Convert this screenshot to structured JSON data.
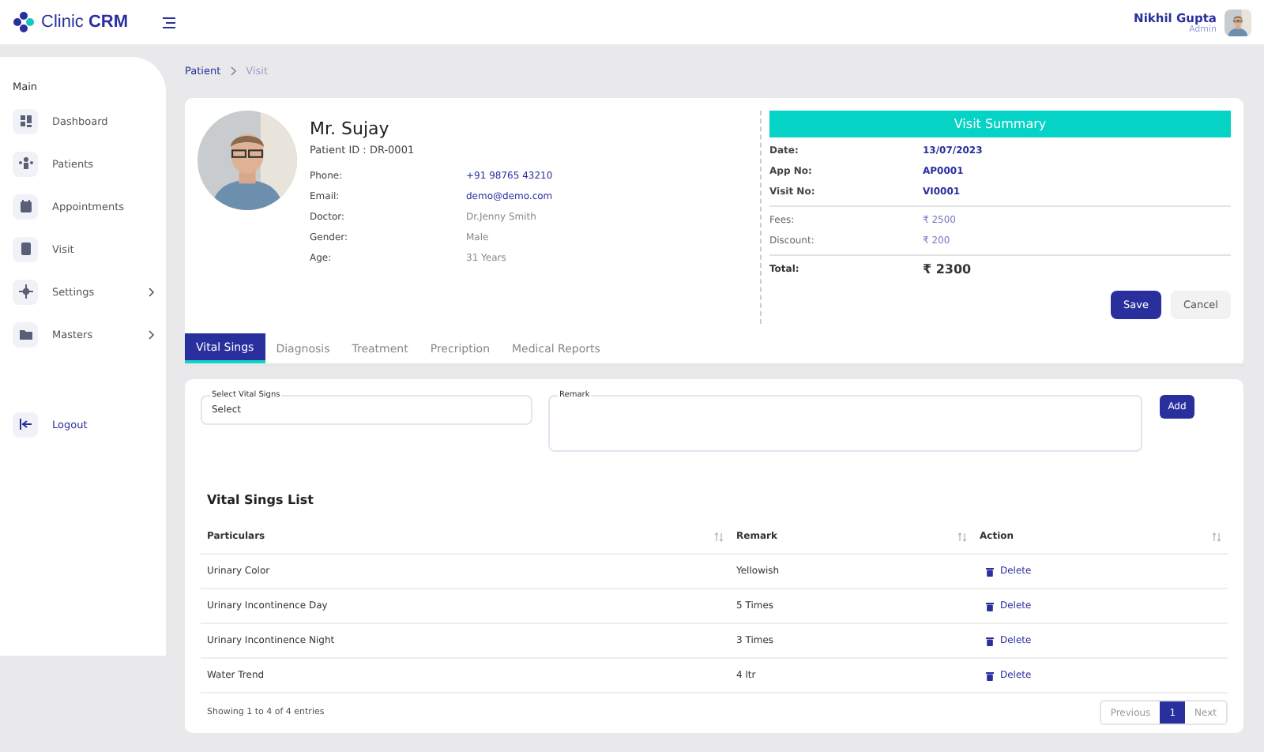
{
  "brand": {
    "name": "Clinic",
    "accent": "CRM"
  },
  "user": {
    "name": "Nikhil Gupta",
    "role": "Admin"
  },
  "sidebar": {
    "section": "Main",
    "items": [
      {
        "label": "Dashboard",
        "expandable": false
      },
      {
        "label": "Patients",
        "expandable": false
      },
      {
        "label": "Appointments",
        "expandable": false
      },
      {
        "label": "Visit",
        "expandable": false
      },
      {
        "label": "Settings",
        "expandable": true
      },
      {
        "label": "Masters",
        "expandable": true
      }
    ],
    "logout": "Logout"
  },
  "breadcrumb": [
    {
      "label": "Patient",
      "selected": false
    },
    {
      "label": "Visit",
      "selected": true
    }
  ],
  "patient": {
    "name": "Mr. Sujay",
    "id_line": "Patient ID : DR-0001",
    "fields": [
      {
        "label": "Phone:",
        "value": "+91 98765 43210",
        "kind": "link"
      },
      {
        "label": "Email:",
        "value": "demo@demo.com",
        "kind": "link"
      },
      {
        "label": "Doctor:",
        "value": "Dr.Jenny Smith",
        "kind": "plain"
      },
      {
        "label": "Gender:",
        "value": "Male",
        "kind": "plain"
      },
      {
        "label": "Age:",
        "value": "31 Years",
        "kind": "plain"
      }
    ]
  },
  "summary": {
    "title": "Visit Summary",
    "sections": [
      {
        "kind": "ids",
        "rows": [
          {
            "label": "Date:",
            "value": "13/07/2023"
          },
          {
            "label": "App No:",
            "value": "AP0001"
          },
          {
            "label": "Visit No:",
            "value": "VI0001"
          }
        ]
      },
      {
        "kind": "charges",
        "rows": [
          {
            "label": "Fees:",
            "value": "₹ 2500"
          },
          {
            "label": "Discount:",
            "value": "₹ 200"
          }
        ]
      },
      {
        "kind": "total",
        "rows": [
          {
            "label": "Total:",
            "value": "₹ 2300"
          }
        ]
      }
    ],
    "buttons": [
      {
        "label": "Save",
        "kind": "primary"
      },
      {
        "label": "Cancel",
        "kind": "secondary"
      }
    ]
  },
  "tabs": [
    {
      "label": "Vital Sings",
      "selected": true
    },
    {
      "label": "Diagnosis",
      "selected": false
    },
    {
      "label": "Treatment",
      "selected": false
    },
    {
      "label": "Precription",
      "selected": false
    },
    {
      "label": "Medical Reports",
      "selected": false
    }
  ],
  "form": {
    "vital": {
      "label": "Select Vital Signs",
      "value": "Select"
    },
    "remark": {
      "label": "Remark"
    },
    "add_button": "Add"
  },
  "table": {
    "title": "Vital Sings List",
    "columns": [
      {
        "label": "Particulars"
      },
      {
        "label": "Remark"
      },
      {
        "label": "Action"
      }
    ],
    "rows": [
      {
        "particulars": "Urinary Color",
        "remark": "Yellowish",
        "action": "Delete"
      },
      {
        "particulars": "Urinary Incontinence Day",
        "remark": "5 Times",
        "action": "Delete"
      },
      {
        "particulars": "Urinary Incontinence Night",
        "remark": "3 Times",
        "action": "Delete"
      },
      {
        "particulars": "Water Trend",
        "remark": "4 ltr",
        "action": "Delete"
      }
    ],
    "info": "Showing 1 to 4 of 4 entries",
    "pagination": {
      "previous": "Previous",
      "pages": [
        {
          "label": "1",
          "selected": true
        }
      ],
      "next": "Next"
    }
  }
}
